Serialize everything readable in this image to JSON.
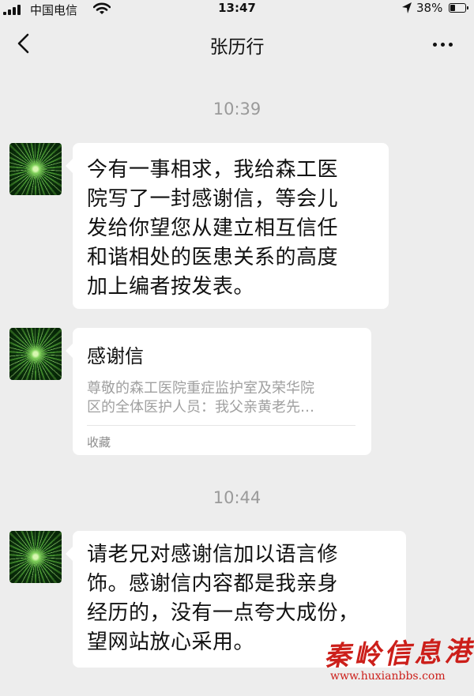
{
  "status_bar": {
    "carrier": "中国电信",
    "time": "13:47",
    "battery": "38%"
  },
  "nav": {
    "title": "张历行"
  },
  "messages": [
    {
      "timestamp": "10:39",
      "text": "今有一事相求，我给森工医\n院写了一封感谢信，等会儿\n发给你望您从建立相互信任\n和谐相处的医患关系的高度\n加上编者按发表。"
    },
    {
      "card_title": "感谢信",
      "card_desc": "尊敬的森工医院重症监护室及荣华院\n区的全体医护人员：我父亲黄老先…",
      "card_source": "收藏"
    },
    {
      "timestamp": "10:44",
      "text": "请老兄对感谢信加以语言修\n饰。感谢信内容都是我亲身\n经历的，没有一点夸大成份，\n望网站放心采用。"
    }
  ],
  "watermark": {
    "name": "秦岭信息港",
    "url": "www.huxianbbs.com"
  },
  "colors": {
    "background": "#ededed",
    "bubble": "#ffffff",
    "timestamp": "#9a9a9a",
    "watermark": "#cc1f1a"
  }
}
